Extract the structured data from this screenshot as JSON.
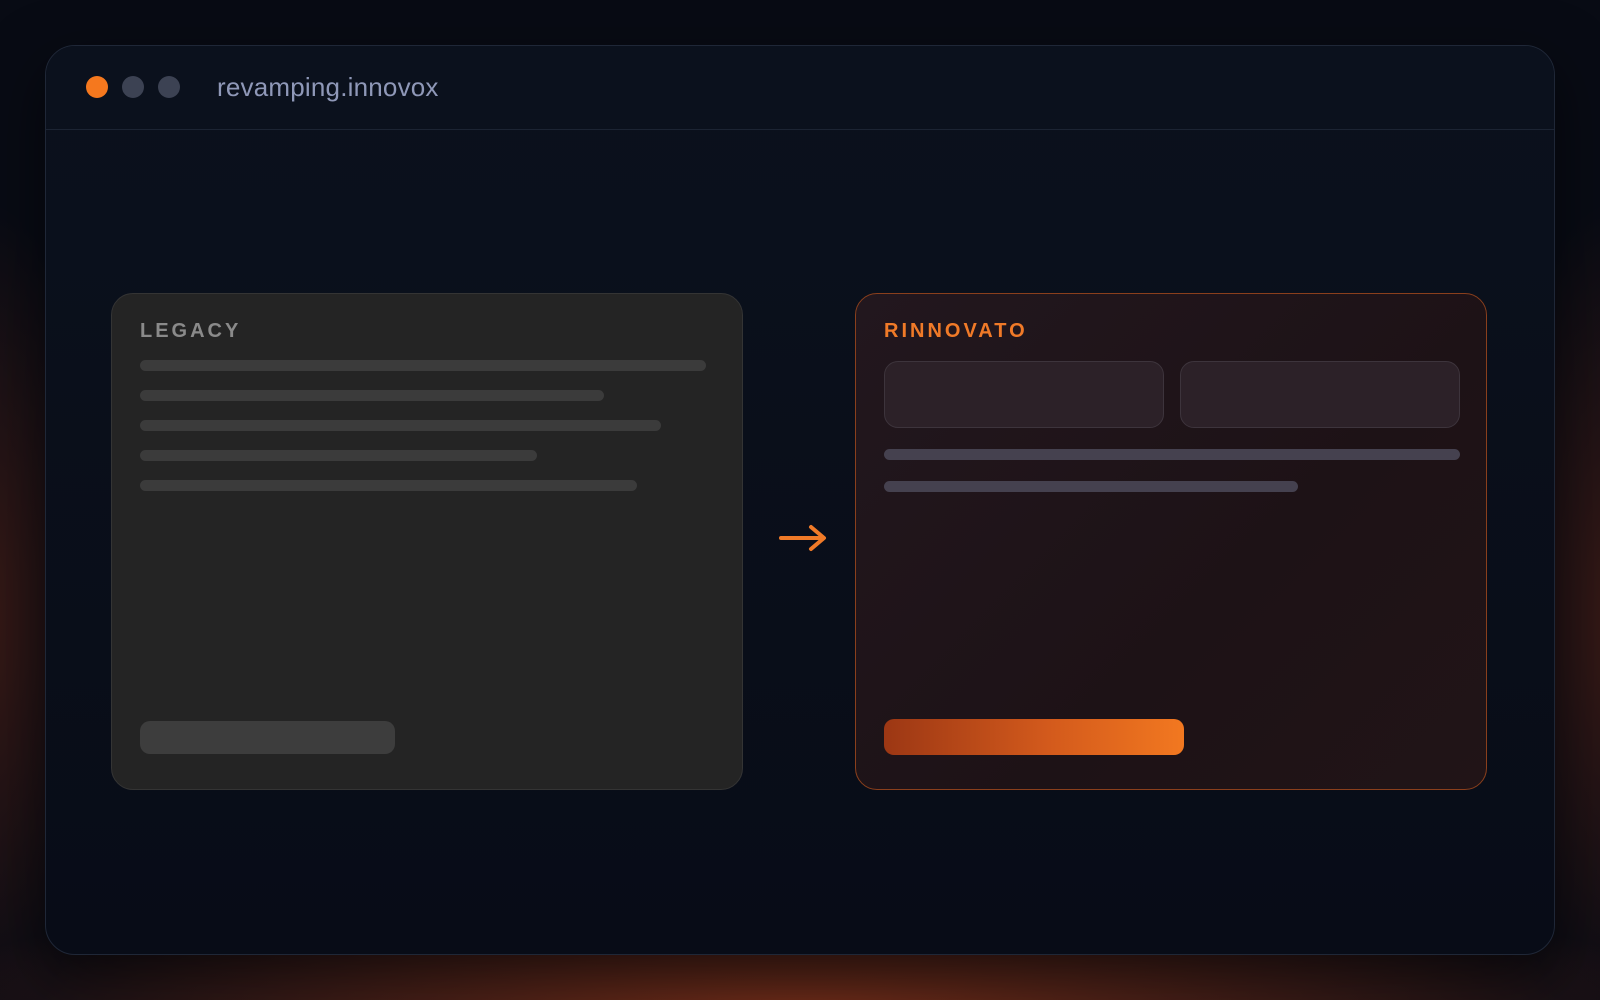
{
  "window": {
    "url": "revamping.innovox",
    "controls": [
      {
        "name": "close",
        "color": "#f5781e"
      },
      {
        "name": "minimize",
        "color": "#3c4253"
      },
      {
        "name": "maximize",
        "color": "#3c4253"
      }
    ]
  },
  "legacy": {
    "label": "LEGACY",
    "color": "#8a8a8a"
  },
  "renewed": {
    "label": "RINNOVATO",
    "accent": "#f07a28"
  },
  "transition": {
    "icon": "arrow-right-icon",
    "color": "#f07a28"
  }
}
